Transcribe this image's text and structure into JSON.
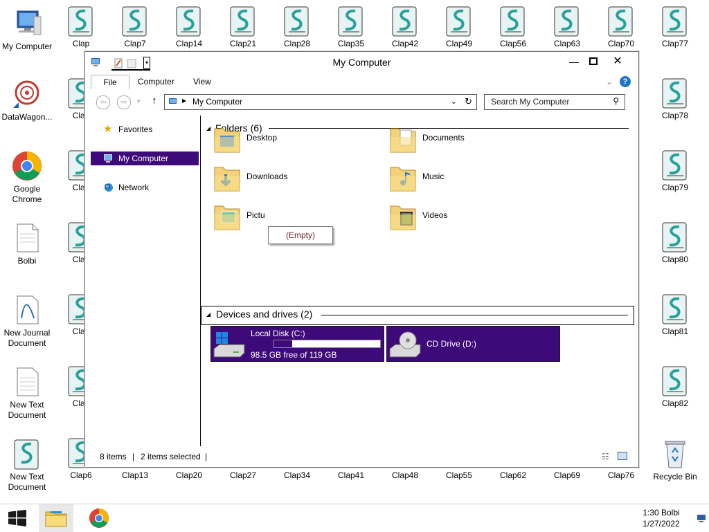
{
  "desktop": {
    "left_icons": [
      {
        "label": "My Computer",
        "icon": "computer-icon"
      },
      {
        "label": "DataWagon...",
        "icon": "datawagon-icon"
      },
      {
        "label": "Google Chrome",
        "icon": "chrome-icon"
      },
      {
        "label": "Bolbi",
        "icon": "document-icon"
      },
      {
        "label": "New Journal Document",
        "icon": "journal-icon"
      },
      {
        "label": "New Text Document",
        "icon": "text-document-icon"
      },
      {
        "label": "New Text Document",
        "icon": "clap-script-icon"
      }
    ],
    "top_row": [
      "Clap",
      "Clap7",
      "Clap14",
      "Clap21",
      "Clap28",
      "Clap35",
      "Clap42",
      "Clap49",
      "Clap56",
      "Clap63",
      "Clap70",
      "Clap77"
    ],
    "left_column_partial": [
      "Clap",
      "Clap",
      "Clap",
      "Clap",
      "Clap"
    ],
    "right_column": [
      "Clap78",
      "Clap79",
      "Clap80",
      "Clap81",
      "Clap82"
    ],
    "bottom_row": [
      "Clap6",
      "Clap13",
      "Clap20",
      "Clap27",
      "Clap34",
      "Clap41",
      "Clap48",
      "Clap55",
      "Clap62",
      "Clap69",
      "Clap76"
    ],
    "recycle_bin": "Recycle Bin"
  },
  "window": {
    "title": "My Computer",
    "tabs": [
      "File",
      "Computer",
      "View"
    ],
    "address": "My Computer",
    "search_placeholder": "Search My Computer",
    "nav": {
      "favorites": "Favorites",
      "my_computer": "My Computer",
      "network": "Network"
    },
    "folders_header": "Folders (6)",
    "folders": [
      "Desktop",
      "Documents",
      "Downloads",
      "Music",
      "Pictu",
      "Videos"
    ],
    "devices_header": "Devices and drives (2)",
    "drives": [
      {
        "name": "Local Disk (C:)",
        "free": "98.5 GB free of 119 GB",
        "used_fraction": 0.17
      },
      {
        "name": "CD Drive (D:)"
      }
    ],
    "tooltip": "(Empty)",
    "status_items": "8 items",
    "status_selected": "2 items selected"
  },
  "taskbar": {
    "time": "1:30 Bolbi",
    "date": "1/27/2022"
  },
  "colors": {
    "selection": "#3e0a7a",
    "script_icon": "#2aa09a"
  }
}
